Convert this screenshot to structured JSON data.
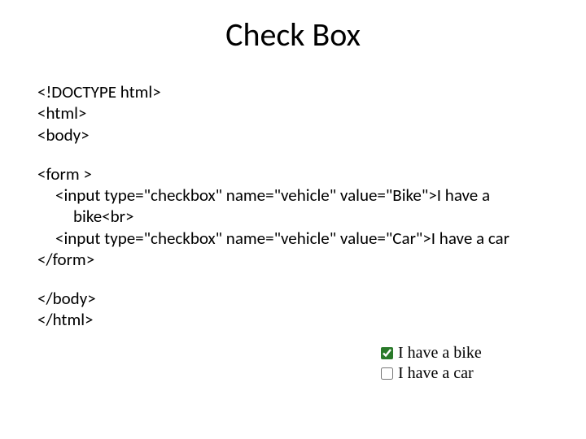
{
  "title": "Check Box",
  "code": {
    "l1": "<!DOCTYPE html>",
    "l2": "<html>",
    "l3": "<body>",
    "l4": "<form >",
    "l5": "<input type=\"checkbox\" name=\"vehicle\" value=\"Bike\">I have a",
    "l5b": "bike<br>",
    "l6": "<input type=\"checkbox\" name=\"vehicle\" value=\"Car\">I have a car",
    "l7": "</form>",
    "l8": "</body>",
    "l9": "</html>"
  },
  "preview": {
    "option1": "I have a bike",
    "option2": "I have a car"
  }
}
